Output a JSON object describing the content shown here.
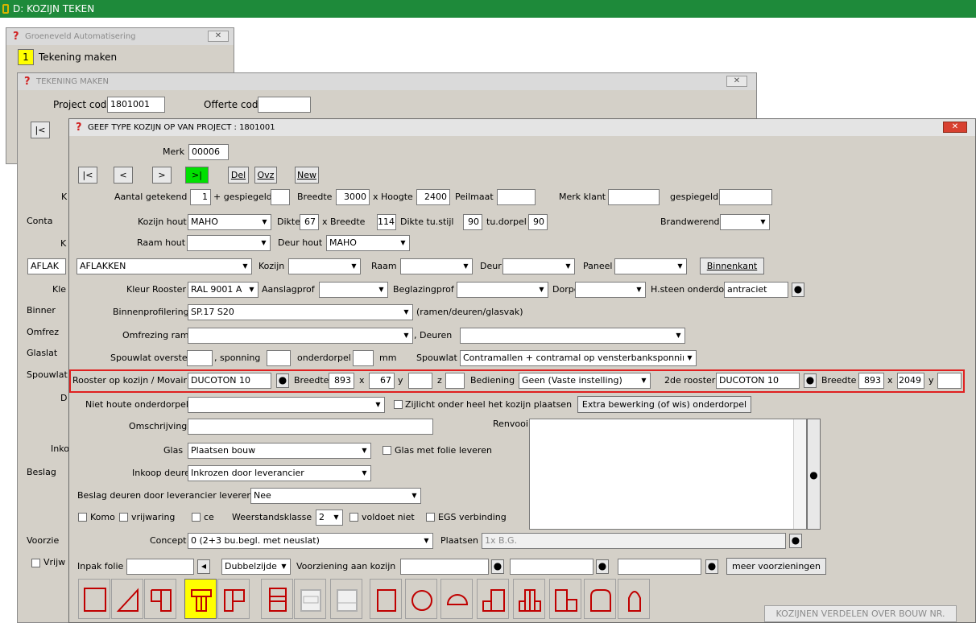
{
  "app": {
    "title": "D: KOZIJN TEKEN"
  },
  "win1": {
    "title": "Groeneveld Automatisering",
    "menu_number": "1",
    "menu_label": "Tekening maken"
  },
  "win2": {
    "title": "TEKENING MAKEN",
    "project_code_label": "Project code",
    "project_code": "1801001",
    "offerte_code_label": "Offerte code",
    "offerte_code": "",
    "nav_first": "|<",
    "side_labels": [
      "K",
      "Conta",
      "K",
      "AFLAK",
      "Kle",
      "Binner",
      "Omfrez",
      "Glaslat",
      "Spouwlat",
      "D",
      "Inko",
      "Beslag",
      "Voorzie",
      "Vrijw"
    ]
  },
  "dialog": {
    "title": "GEEF TYPE KOZIJN OP  VAN PROJECT : 1801001",
    "merk_label": "Merk",
    "merk": "00006",
    "nav": [
      "|<",
      "<",
      ">",
      ">|",
      "Del",
      "Ovz",
      "New"
    ],
    "aantal_label": "Aantal getekend",
    "aantal": "1",
    "gespiegeld_label": "+ gespiegeld",
    "gespiegeld": "",
    "breedte_label": "Breedte",
    "breedte": "3000",
    "hoogte_label": "x Hoogte",
    "hoogte": "2400",
    "peilmaat_label": "Peilmaat",
    "peilmaat": "",
    "merk_klant_label": "Merk klant",
    "merk_klant": "",
    "gespiegeld2_label": "gespiegeld",
    "gespiegeld2": "",
    "kozijn_hout_label": "Kozijn hout",
    "kozijn_hout": "MAHO",
    "dikte_label": "Dikte",
    "dikte": "67",
    "xbreedte_label": "x Breedte",
    "xbreedte": "114",
    "dikte_tu_label": "Dikte tu.stijl",
    "dikte_tu": "90",
    "tu_dorpel_label": "tu.dorpel",
    "tu_dorpel": "90",
    "brandwerend_label": "Brandwerend",
    "brandwerend": "",
    "raam_hout_label": "Raam hout",
    "raam_hout": "",
    "deur_hout_label": "Deur hout",
    "deur_hout": "MAHO",
    "afwerking": "AFLAKKEN",
    "kozijn_label": "Kozijn",
    "kozijn": "",
    "raam_label": "Raam",
    "raam": "",
    "deur_label": "Deur",
    "deur": "",
    "paneel_label": "Paneel",
    "paneel": "",
    "binnenkant_label": "Binnenkant",
    "kleur_rooster_label": "Kleur Rooster",
    "kleur_rooster": "RAL 9001 A",
    "aanslagprof_label": "Aanslagprof",
    "aanslagprof": "",
    "beglazingprof_label": "Beglazingprof",
    "beglazingprof": "",
    "dorpelafd_label": "Dorpelafd",
    "dorpelafd": "",
    "hsteen_label": "H.steen onderdo",
    "hsteen": "antraciet",
    "binnenprofilering_label": "Binnenprofilering",
    "binnenprofilering": "SP.17 S20",
    "binnenprofilering_note": "(ramen/deuren/glasvak)",
    "omfrezing_label": "Omfrezing ramen",
    "omfrezing": "",
    "deuren_label": ", Deuren",
    "deuren": "",
    "spouwlat_oversteek_label": "Spouwlat oversteek",
    "spouwlat_oversteek": "",
    "sponning_label": ", sponning",
    "sponning": "",
    "onderdorpel_label": "onderdorpel",
    "onderdorpel": "",
    "mm_label": "mm",
    "spouwlat_label": "Spouwlat",
    "spouwlat": "Contramallen + contramal op vensterbanksponning",
    "rooster_label": "Rooster op kozijn / Movair",
    "rooster": "DUCOTON 10",
    "rooster_breedte_label": "Breedte",
    "rooster_breedte": "893",
    "x_label": "x",
    "rooster_h": "67",
    "y_label": "y",
    "rooster_y": "",
    "z_label": "z",
    "rooster_z": "",
    "bediening_label": "Bediening",
    "bediening": "Geen (Vaste instelling)",
    "rooster2_label": "2de rooster",
    "rooster2": "DUCOTON 10",
    "rooster2_breedte_label": "Breedte",
    "rooster2_breedte": "893",
    "rooster2_h": "2049",
    "rooster2_y": "",
    "niet_houte_label": "Niet houte onderdorpel",
    "niet_houte": "",
    "zijlicht_label": "Zijlicht onder heel het kozijn plaatsen",
    "extra_label": "Extra bewerking (of wis) onderdorpel",
    "omschrijving_label": "Omschrijving",
    "omschrijving": "",
    "renvooi_label": "Renvooi",
    "glas_label": "Glas",
    "glas": "Plaatsen bouw",
    "glas_folie_label": "Glas met folie leveren",
    "inkoop_label": "Inkoop deuren",
    "inkoop": "Inkrozen door leverancier",
    "beslag_label": "Beslag deuren door leverancier leveren",
    "beslag": "Nee",
    "komo_label": "Komo",
    "vrijwaring_label": "vrijwaring",
    "ce_label": "ce",
    "weerstand_label": "Weerstandsklasse",
    "weerstand": "2",
    "voldoet_label": "voldoet niet",
    "egs_label": "EGS verbinding",
    "concept_label": "Concept",
    "concept": "0  (2+3 bu.begl. met neuslat)",
    "plaatsen_label": "Plaatsen",
    "plaatsen": "1x B.G.",
    "inpak_label": "Inpak folie",
    "inpak": "",
    "dubbelzijde": "Dubbelzijde",
    "voorziening_label": "Voorziening aan kozijn",
    "voorziening1": "",
    "voorziening2": "",
    "voorziening3": "",
    "meer_label": "meer voorzieningen",
    "verdelen_label": "KOZIJNEN VERDELEN OVER BOUW NR.",
    "shapes": [
      "square",
      "triangle",
      "double-window",
      "t-window",
      "l-window",
      "split-window",
      "glass-pane",
      "glass-pane-2",
      "rectangle",
      "circle",
      "half-circle",
      "arch",
      "step-left",
      "step-double",
      "step-right",
      "rounded",
      "gothic-arch"
    ]
  },
  "colors": {
    "titlebar": "#1e8a3a",
    "highlight": "#e02020",
    "nav_active": "#00e000",
    "shape_selected": "#ffff00",
    "window": "#d4d0c8"
  }
}
